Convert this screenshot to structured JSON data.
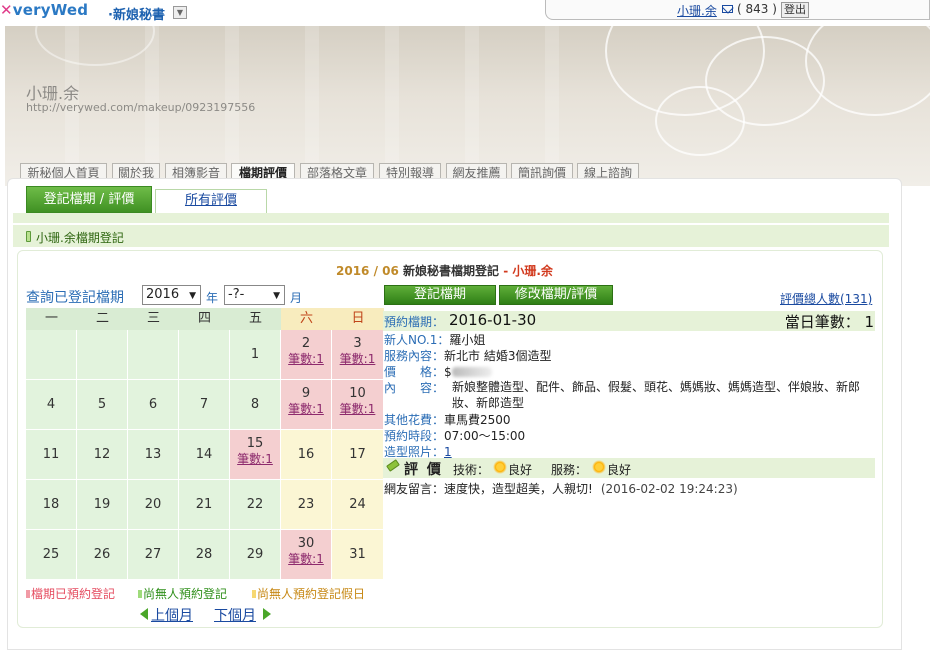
{
  "topbar": {
    "logo_text": "veryWed",
    "menu_label": "·新娘秘書",
    "user_name": "小珊.余",
    "mail_count": "( 843 )",
    "logout_label": "登出"
  },
  "header": {
    "owner_name": "小珊.余",
    "owner_url": "http://verywed.com/makeup/0923197556"
  },
  "nav": {
    "items": [
      "新秘個人首頁",
      "關於我",
      "相簿影音",
      "檔期評價",
      "部落格文章",
      "特別報導",
      "網友推薦",
      "簡訊詢價",
      "線上諮詢"
    ],
    "active_index": 3
  },
  "tabs": {
    "register": "登記檔期 / 評價",
    "all": "所有評價"
  },
  "section_title": "小珊.余檔期登記",
  "month_title": {
    "year_month": "2016 / 06",
    "label": " 新娘秘書檔期登記 ",
    "name": "- 小珊.余"
  },
  "query": {
    "label": "查詢已登記檔期",
    "year_value": "2016",
    "year_unit": "年",
    "month_value": "-?-",
    "month_unit": "月"
  },
  "calendar": {
    "weekdays": [
      "一",
      "二",
      "三",
      "四",
      "五",
      "六",
      "日"
    ],
    "count_label": "筆數:1",
    "weeks": [
      [
        null,
        null,
        null,
        null,
        "1",
        "2",
        "3"
      ],
      [
        "4",
        "5",
        "6",
        "7",
        "8",
        "9",
        "10"
      ],
      [
        "11",
        "12",
        "13",
        "14",
        "15",
        "16",
        "17"
      ],
      [
        "18",
        "19",
        "20",
        "21",
        "22",
        "23",
        "24"
      ],
      [
        "25",
        "26",
        "27",
        "28",
        "29",
        "30",
        "31"
      ]
    ],
    "booked": [
      [
        0,
        5
      ],
      [
        0,
        6
      ],
      [
        1,
        5
      ],
      [
        1,
        6
      ],
      [
        2,
        4
      ],
      [
        4,
        5
      ]
    ]
  },
  "legend": {
    "booked": "檔期已預約登記",
    "free": "尚無人預約登記",
    "holiday": "尚無人預約登記假日"
  },
  "pager": {
    "prev": "上個月",
    "next": "下個月"
  },
  "actions": {
    "register": "登記檔期",
    "modify": "修改檔期/評價",
    "total_reviews": "評價總人數(131)"
  },
  "booking": {
    "label": "預約檔期：",
    "date": "2016-01-30",
    "daily_count": "當日筆數：  1",
    "new_label": "新人NO.1：",
    "new_value": "羅小姐",
    "service_label": "服務內容：",
    "service_value": "新北市 結婚3個造型",
    "price_label": "價　　格：",
    "price_value": "$",
    "content_label": "內　　容：",
    "content_value": "新娘整體造型、配件、飾品、假髮、頭花、媽媽妝、媽媽造型、伴娘妝、新郎妝、新郎造型",
    "other_label": "其他花費：",
    "other_value": "車馬費2500",
    "time_label": "預約時段：",
    "time_value": "07:00～15:00",
    "photo_label": "造型照片：",
    "photo_value": "1"
  },
  "review": {
    "title": "評 價",
    "tech_label": "技術：",
    "tech_rating": "良好",
    "service_label": "服務：",
    "service_rating": "良好"
  },
  "comment": {
    "label": "網友留言：",
    "text": "速度快，造型超美，人親切!",
    "date": "(2016-02-02 19:24:23)"
  },
  "colors": {
    "brand_blue": "#2b79c4",
    "green_button": "#3f9123",
    "booked_pink": "#f4cfd0",
    "weekday_green": "#e2f3dd",
    "weekend_yellow": "#fbf6d4"
  }
}
